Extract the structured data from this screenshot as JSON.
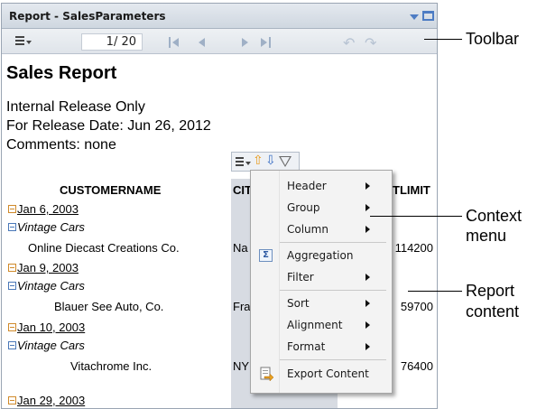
{
  "window": {
    "title": "Report - SalesParameters"
  },
  "toolbar": {
    "page_indicator": "1/ 20"
  },
  "report": {
    "title": "Sales Report",
    "lines": [
      "Internal Release Only",
      "For Release Date: Jun 26, 2012",
      "Comments: none"
    ],
    "columns": {
      "customer": "CUSTOMERNAME",
      "city": "CIT",
      "limit": "TLIMIT"
    },
    "groups": [
      {
        "date": "Jan 6, 2003",
        "product_line": "Vintage Cars",
        "customer": "Online Diecast Creations Co.",
        "city": "Na",
        "limit": "114200"
      },
      {
        "date": "Jan 9, 2003",
        "product_line": "Vintage Cars",
        "customer": "Blauer See Auto, Co.",
        "city": "Fra",
        "limit": "59700"
      },
      {
        "date": "Jan 10, 2003",
        "product_line": "Vintage Cars",
        "customer": "Vitachrome Inc.",
        "city": "NY",
        "limit": "76400"
      },
      {
        "date": "Jan 29, 2003"
      }
    ]
  },
  "context_menu": {
    "items": [
      {
        "label": "Header",
        "submenu": true
      },
      {
        "label": "Group",
        "submenu": true
      },
      {
        "label": "Column",
        "submenu": true
      },
      {
        "label": "Aggregation",
        "submenu": false,
        "icon": "sigma-icon"
      },
      {
        "label": "Filter",
        "submenu": true
      },
      {
        "label": "Sort",
        "submenu": true
      },
      {
        "label": "Alignment",
        "submenu": true
      },
      {
        "label": "Format",
        "submenu": true
      },
      {
        "label": "Export Content",
        "submenu": false,
        "icon": "export-icon"
      }
    ]
  },
  "callouts": {
    "toolbar": "Toolbar",
    "context_menu_1": "Context",
    "context_menu_2": "menu",
    "report_content_1": "Report",
    "report_content_2": "content"
  },
  "colors": {
    "accent": "#4d7cc4",
    "group_marker": "#d08a2a"
  }
}
